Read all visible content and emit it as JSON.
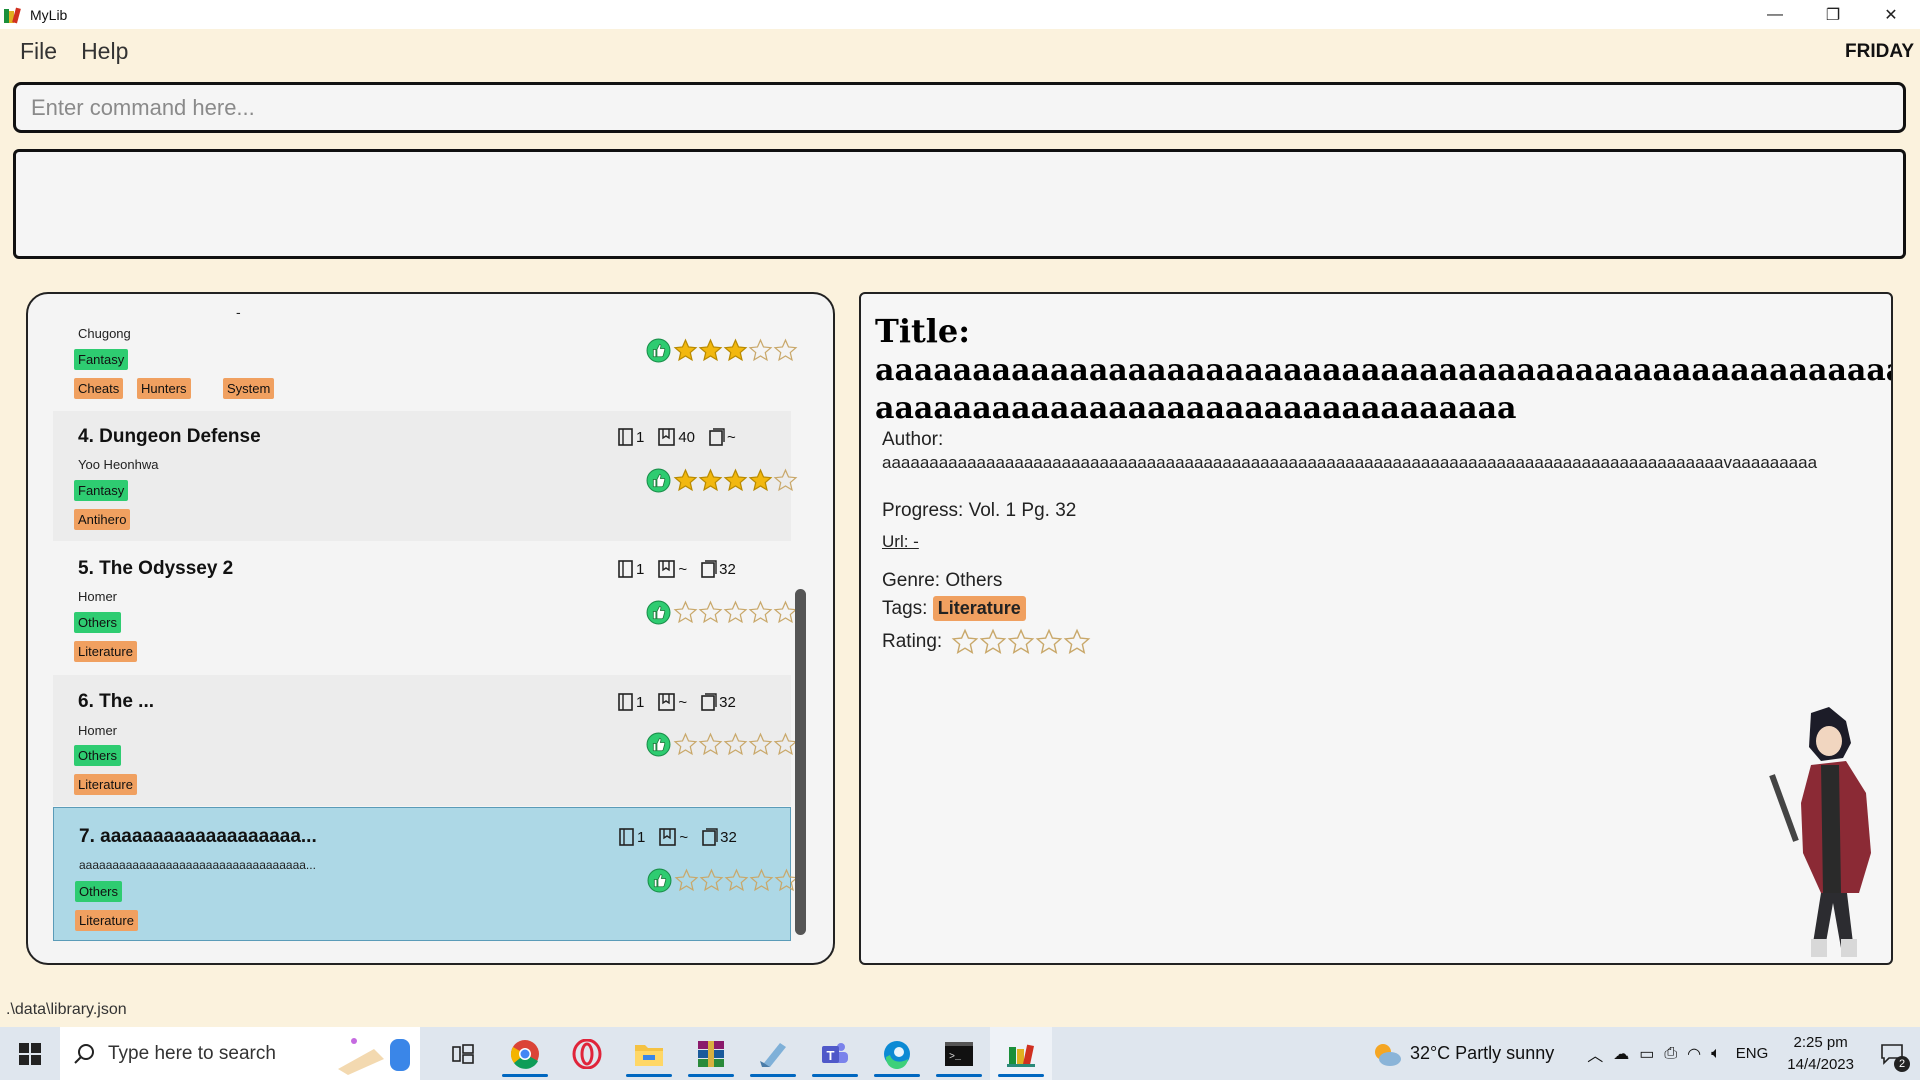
{
  "window": {
    "title": "MyLib",
    "minimize": "—",
    "restore": "❐",
    "close": "✕"
  },
  "menu": {
    "items": [
      "File",
      "Help"
    ],
    "day": "FRIDAY"
  },
  "command": {
    "placeholder": "Enter command here..."
  },
  "list": {
    "cards": [
      {
        "title": "",
        "dash": "-",
        "author": "Chugong",
        "genre": "Fantasy",
        "tags": [
          "Cheats",
          "Hunters",
          "System"
        ],
        "rating": 3
      },
      {
        "title": "4. Dungeon Defense",
        "author": "Yoo Heonhwa",
        "genre": "Fantasy",
        "tags": [
          "Antihero"
        ],
        "volume": "1",
        "page": "40",
        "chapter": "~",
        "rating": 4
      },
      {
        "title": "5. The Odyssey 2",
        "author": "Homer",
        "genre": "Others",
        "tags": [
          "Literature"
        ],
        "volume": "1",
        "page": "~",
        "chapter": "32",
        "rating": 0
      },
      {
        "title": "6. The ...",
        "author": "Homer",
        "genre": "Others",
        "tags": [
          "Literature"
        ],
        "volume": "1",
        "page": "~",
        "chapter": "32",
        "rating": 0
      },
      {
        "title": "7. aaaaaaaaaaaaaaaaaaa...",
        "author": "aaaaaaaaaaaaaaaaaaaaaaaaaaaaaaaaaa...",
        "genre": "Others",
        "tags": [
          "Literature"
        ],
        "volume": "1",
        "page": "~",
        "chapter": "32",
        "rating": 0
      }
    ]
  },
  "detail": {
    "title_label": "Title:",
    "title_value": "aaaaaaaaaaaaaaaaaaaaaaaaaaaaaaaaaaaaaaaaaaaaaaaaaaaaaaaaaaaaaaaaaaaaaaaaaaaaaaaaaaaaaaaaaaaaaa",
    "author_label": "Author:",
    "author_value": "aaaaaaaaaaaaaaaaaaaaaaaaaaaaaaaaaaaaaaaaaaaaaaaaaaaaaaaaaaaaaaaaaaaaaaaaaaaaaaaaaaaaaaaaavaaaaaaaaa",
    "progress": "Progress: Vol. 1 Pg. 32",
    "url": "Url: -",
    "genre": "Genre: Others",
    "tags_label": "Tags:",
    "tag": "Literature",
    "rating_label": "Rating:",
    "rating": 0
  },
  "status": {
    "path": ".\\data\\library.json"
  },
  "taskbar": {
    "search_placeholder": "Type here to search",
    "weather": "32°C  Partly sunny",
    "lang": "ENG",
    "time": "2:25 pm",
    "date": "14/4/2023",
    "notifications": "2"
  },
  "colors": {
    "background": "#fbf2dd",
    "genre_tag": "#2ecc71",
    "label_tag": "#f0a060",
    "selected_card": "#add8e6",
    "star": "#f2b80f"
  }
}
